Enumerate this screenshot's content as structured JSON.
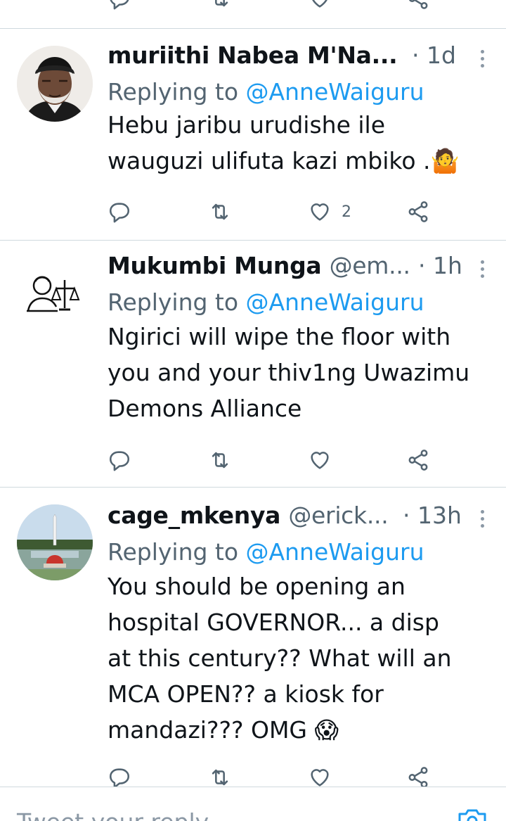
{
  "tweets": [
    {
      "name": "muriithi Nabea M'Na...",
      "handle": "",
      "time": "· 1d",
      "replying_prefix": "Replying to ",
      "replying_to": "@AnneWaiguru",
      "text_lines": [
        "Hebu jaribu urudishe ile",
        "wauguzi ulifuta kazi mbiko .🤷"
      ],
      "like_count": "2"
    },
    {
      "name": "Mukumbi Munga",
      "handle": "@em...",
      "time": "· 1h",
      "replying_prefix": "Replying to ",
      "replying_to": "@AnneWaiguru",
      "text_lines": [
        "Ngirici will wipe the floor with",
        "you and your thiv1ng Uwazimu",
        "Demons Alliance"
      ],
      "like_count": ""
    },
    {
      "name": "cage_mkenya",
      "handle": "@erick...",
      "time": "· 13h",
      "replying_prefix": "Replying to ",
      "replying_to": "@AnneWaiguru",
      "text_lines": [
        "You should be opening an",
        "hospital GOVERNOR... a disp",
        "at this century??  What will an",
        "MCA OPEN?? a kiosk for",
        "mandazi??? OMG 😱"
      ],
      "like_count": ""
    }
  ],
  "composer": {
    "placeholder": "Tweet your reply"
  },
  "icons": {
    "reply": "reply-icon",
    "retweet": "retweet-icon",
    "like": "heart-icon",
    "share": "share-icon",
    "more": "more-icon",
    "camera": "camera-icon"
  },
  "colors": {
    "accent": "#1d9bf0",
    "secondary_text": "#536471",
    "divider": "#cfd9de"
  }
}
